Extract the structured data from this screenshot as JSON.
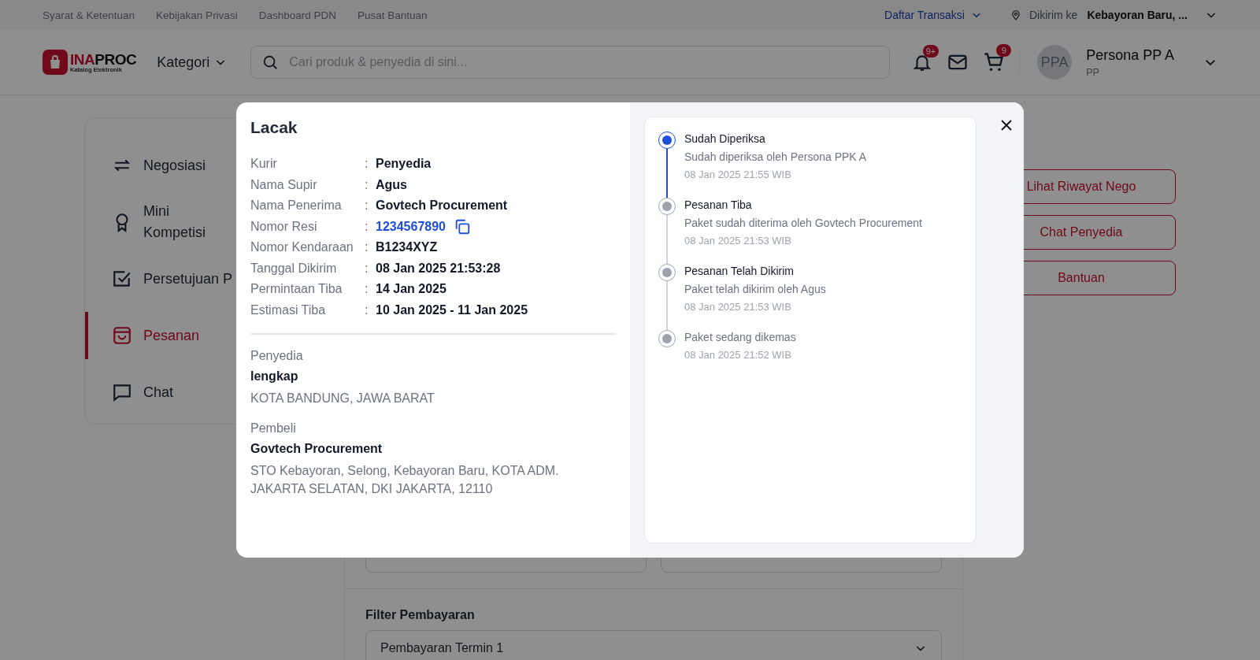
{
  "top_bar": {
    "links": [
      "Syarat & Ketentuan",
      "Kebijakan Privasi",
      "Dashboard PDN",
      "Pusat Bantuan"
    ],
    "transactions": "Daftar Transaksi",
    "ship_label": "Dikirim ke",
    "ship_to": "Kebayoran Baru, ..."
  },
  "header": {
    "logo": {
      "parts": [
        "INA",
        "PROC"
      ],
      "subtitle": "Katalog Elektronik"
    },
    "category": "Kategori",
    "search": {
      "placeholder": "Cari produk & penyedia di sini..."
    },
    "notification_badge": "9+",
    "cart_badge": "9",
    "user": {
      "initials": "PPA",
      "name": "Persona PP A",
      "role": "PP"
    }
  },
  "sidebar": {
    "items": [
      {
        "label": "Negosiasi",
        "selected": false
      },
      {
        "label": "Mini Kompetisi",
        "selected": false
      },
      {
        "label": "Persetujuan P",
        "selected": false
      },
      {
        "label": "Pesanan",
        "selected": true
      },
      {
        "label": "Chat",
        "selected": false
      }
    ]
  },
  "actions": [
    "Lihat Riwayat Nego",
    "Chat Penyedia",
    "Bantuan"
  ],
  "content": {
    "filter_label": "Filter Pembayaran",
    "payment_select": {
      "value": "Pembayaran Termin 1"
    }
  },
  "modal": {
    "title": "Lacak",
    "details": [
      {
        "label": "Kurir",
        "separator": ":",
        "value": "Penyedia",
        "kind": "text"
      },
      {
        "label": "Nama Supir",
        "separator": ":",
        "value": "Agus",
        "kind": "text"
      },
      {
        "label": "Nama Penerima",
        "separator": ":",
        "value": "Govtech Procurement",
        "kind": "text"
      },
      {
        "label": "Nomor Resi",
        "separator": ":",
        "value": "1234567890",
        "kind": "copy"
      },
      {
        "label": "Nomor Kendaraan",
        "separator": ":",
        "value": "B1234XYZ",
        "kind": "text"
      },
      {
        "label": "Tanggal Dikirim",
        "separator": ":",
        "value": "08 Jan 2025 21:53:28",
        "kind": "text"
      },
      {
        "label": "Permintaan Tiba",
        "separator": ":",
        "value": "14 Jan 2025",
        "kind": "text"
      },
      {
        "label": "Estimasi Tiba",
        "separator": ":",
        "value": "10 Jan 2025 - 11 Jan 2025",
        "kind": "text"
      }
    ],
    "parties": [
      {
        "heading": "Penyedia",
        "name": "lengkap",
        "address": "KOTA BANDUNG, JAWA BARAT"
      },
      {
        "heading": "Pembeli",
        "name": "Govtech Procurement",
        "address": "STO Kebayoran, Selong, Kebayoran Baru, KOTA ADM. JAKARTA SELATAN, DKI JAKARTA, 12110"
      }
    ],
    "tracking": [
      {
        "title": "Sudah Diperiksa",
        "description": "Sudah diperiksa oleh Persona PPK A",
        "time": "08 Jan 2025 21:55 WIB",
        "active": true
      },
      {
        "title": "Pesanan Tiba",
        "description": "Paket sudah diterima oleh Govtech Procurement",
        "time": "08 Jan 2025 21:53 WIB",
        "active": false
      },
      {
        "title": "Pesanan Telah Dikirim",
        "description": "Paket telah dikirim oleh Agus",
        "time": "08 Jan 2025 21:53 WIB",
        "active": false
      },
      {
        "description": "Paket sedang dikemas",
        "time": "08 Jan 2025 21:52 WIB",
        "active": false
      }
    ]
  }
}
